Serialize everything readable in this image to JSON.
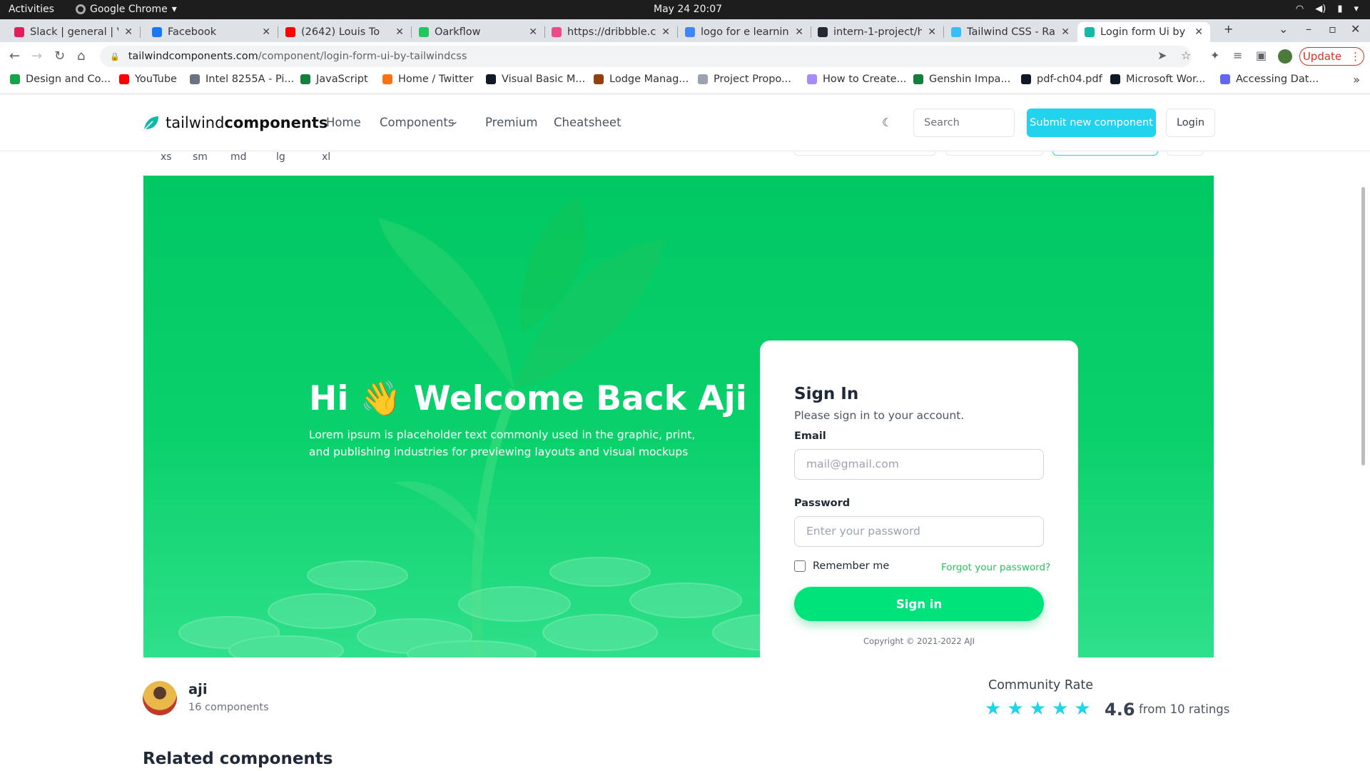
{
  "os_bar": {
    "activities": "Activities",
    "app_name": "Google Chrome",
    "clock": "May 24  20:07"
  },
  "browser": {
    "tabs": [
      {
        "label": "Slack | general | Ve",
        "color": "#e01e5a"
      },
      {
        "label": "Facebook",
        "color": "#1877f2"
      },
      {
        "label": "(2642) Louis To",
        "color": "#ff0000"
      },
      {
        "label": "Oarkflow",
        "color": "#22c55e"
      },
      {
        "label": "https://dribbble.c",
        "color": "#ea4c89"
      },
      {
        "label": "logo for e learning",
        "color": "#4285f4"
      },
      {
        "label": "intern-1-project/h",
        "color": "#24292f"
      },
      {
        "label": "Tailwind CSS - Rap",
        "color": "#38bdf8"
      },
      {
        "label": "Login form Ui by T",
        "color": "#14b8a6"
      }
    ],
    "url_host": "tailwindcomponents.com",
    "url_path": "/component/login-form-ui-by-tailwindcss",
    "update_label": "Update",
    "bookmarks": [
      {
        "label": "Design and Co...",
        "color": "#16a34a"
      },
      {
        "label": "YouTube",
        "color": "#ff0000"
      },
      {
        "label": "Intel 8255A - Pi...",
        "color": "#6b7280"
      },
      {
        "label": "JavaScript",
        "color": "#15803d"
      },
      {
        "label": "Home / Twitter",
        "color": "#f97316"
      },
      {
        "label": "Visual Basic M...",
        "color": "#111827"
      },
      {
        "label": "Lodge Manag...",
        "color": "#92400e"
      },
      {
        "label": "Project Propo...",
        "color": "#9ca3af"
      },
      {
        "label": "How to Create...",
        "color": "#a78bfa"
      },
      {
        "label": "Genshin Impa...",
        "color": "#15803d"
      },
      {
        "label": "pdf-ch04.pdf",
        "color": "#111827"
      },
      {
        "label": "Microsoft Wor...",
        "color": "#111827"
      },
      {
        "label": "Accessing Dat...",
        "color": "#6366f1"
      }
    ]
  },
  "site": {
    "logo_light": "tailwind",
    "logo_bold": "components",
    "nav": [
      "Home",
      "Components",
      "Premium",
      "Cheatsheet"
    ],
    "search_placeholder": "Search",
    "submit_label": "Submit new component",
    "login_label": "Login",
    "sizes": [
      "xs",
      "sm",
      "md",
      "lg",
      "xl"
    ]
  },
  "preview": {
    "welcome_title": "Hi 👋 Welcome Back Aji",
    "welcome_text": "Lorem ipsum is placeholder text commonly used in the graphic, print, and publishing industries for previewing layouts and visual mockups",
    "card": {
      "title": "Sign In",
      "subtitle": "Please sign in to your account.",
      "email_label": "Email",
      "email_placeholder": "mail@gmail.com",
      "password_label": "Password",
      "password_placeholder": "Enter your password",
      "remember_label": "Remember me",
      "forgot_label": "Forgot your password?",
      "signin_label": "Sign in",
      "copyright": "Copyright © 2021-2022 AJI"
    }
  },
  "author": {
    "name": "aji",
    "components": "16 components"
  },
  "rating": {
    "title": "Community Rate",
    "value": "4.6",
    "count": "from 10 ratings",
    "stars": 5
  },
  "related_title": "Related components"
}
